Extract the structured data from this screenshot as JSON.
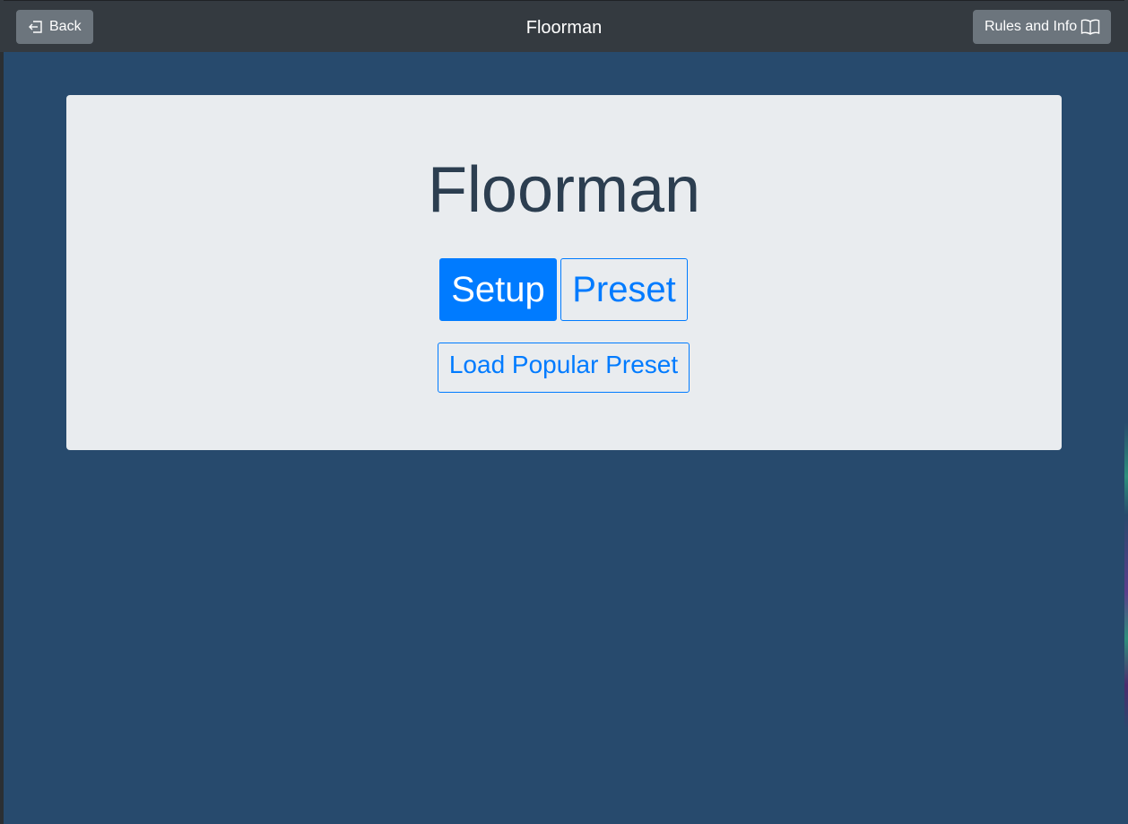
{
  "topbar": {
    "title": "Floorman",
    "back_label": "Back",
    "back_icon": "box-arrow-left-icon",
    "rules_label": "Rules and Info",
    "rules_icon": "book-icon"
  },
  "card": {
    "title": "Floorman",
    "setup_label": "Setup",
    "preset_label": "Preset",
    "load_preset_label": "Load Popular Preset"
  },
  "colors": {
    "navbar": "#343a40",
    "background": "#274a6d",
    "card": "#e9ecef",
    "primary": "#007bff",
    "secondary_button": "#6c757d",
    "title_text": "#2c3e50"
  }
}
